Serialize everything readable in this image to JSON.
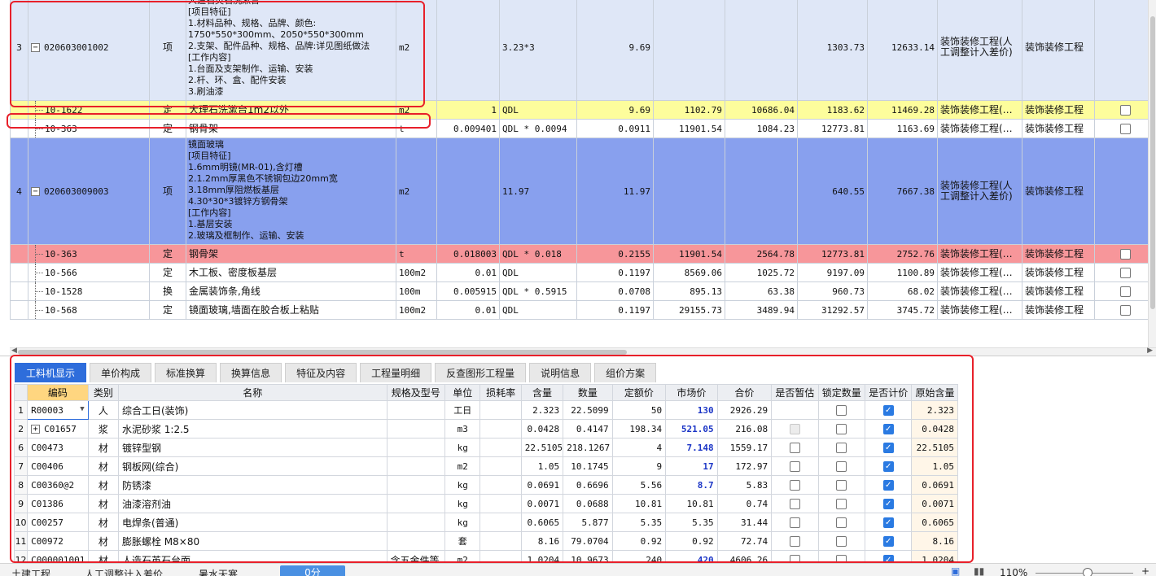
{
  "top_rows": [
    {
      "kind": "item",
      "style": "lt",
      "rownum": "3",
      "code": "020603001002",
      "type": "项",
      "desc_lines": [
        "人造石英石洗漱台",
        "[项目特征]",
        "1.材料品种、规格、品牌、颜色:",
        "1750*550*300mm、2050*550*300mm",
        "2.支架、配件品种、规格、品牌:详见图纸做法",
        "[工作内容]",
        "1.台面及支架制作、运输、安装",
        "2.杆、环、盒、配件安装",
        "3.刷油漆"
      ],
      "unit": "m2",
      "coef": "",
      "expr": "3.23*3",
      "qty": "9.69",
      "price": "",
      "amount": "",
      "comp_price": "1303.73",
      "comp_amount": "12633.14",
      "project": "装饰装修工程(人工调整计入差价)",
      "project2": "装饰装修工程",
      "check": false
    },
    {
      "kind": "sub",
      "style": "yl",
      "code": "10-1622",
      "type": "定",
      "desc": "大理石洗漱台1m2以外",
      "unit": "m2",
      "coef": "1",
      "expr": "QDL",
      "qty": "9.69",
      "price": "1102.79",
      "amount": "10686.04",
      "comp_price": "1183.62",
      "comp_amount": "11469.28",
      "project": "装饰装修工程(…",
      "project2": "装饰装修工程",
      "check": true
    },
    {
      "kind": "sub",
      "style": "wh",
      "code": "10-363",
      "type": "定",
      "desc": "钢骨架",
      "unit": "t",
      "coef": "0.009401",
      "expr": "QDL * 0.0094",
      "qty": "0.0911",
      "price": "11901.54",
      "amount": "1084.23",
      "comp_price": "12773.81",
      "comp_amount": "1163.69",
      "project": "装饰装修工程(…",
      "project2": "装饰装修工程",
      "check": true
    },
    {
      "kind": "item",
      "style": "bl",
      "rownum": "4",
      "code": "020603009003",
      "type": "项",
      "desc_lines": [
        "镜面玻璃",
        "[项目特征]",
        "1.6mm明镜(MR-01),含灯槽",
        "2.1.2mm厚黑色不锈钢包边20mm宽",
        "3.18mm厚阻燃板基层",
        "4.30*30*3镀锌方钢骨架",
        "[工作内容]",
        "1.基层安装",
        "2.玻璃及框制作、运输、安装"
      ],
      "unit": "m2",
      "coef": "",
      "expr": "11.97",
      "qty": "11.97",
      "price": "",
      "amount": "",
      "comp_price": "640.55",
      "comp_amount": "7667.38",
      "project": "装饰装修工程(人工调整计入差价)",
      "project2": "装饰装修工程",
      "check": false
    },
    {
      "kind": "sub",
      "style": "rd",
      "code": "10-363",
      "type": "定",
      "desc": "钢骨架",
      "unit": "t",
      "coef": "0.018003",
      "expr": "QDL * 0.018",
      "qty": "0.2155",
      "price": "11901.54",
      "amount": "2564.78",
      "comp_price": "12773.81",
      "comp_amount": "2752.76",
      "project": "装饰装修工程(…",
      "project2": "装饰装修工程",
      "check": true
    },
    {
      "kind": "sub",
      "style": "wh",
      "code": "10-566",
      "type": "定",
      "desc": "木工板、密度板基层",
      "unit": "100m2",
      "coef": "0.01",
      "expr": "QDL",
      "qty": "0.1197",
      "price": "8569.06",
      "amount": "1025.72",
      "comp_price": "9197.09",
      "comp_amount": "1100.89",
      "project": "装饰装修工程(…",
      "project2": "装饰装修工程",
      "check": true
    },
    {
      "kind": "sub",
      "style": "wh",
      "code": "10-1528",
      "type": "换",
      "desc": "金属装饰条,角线",
      "unit": "100m",
      "coef": "0.005915",
      "expr": "QDL * 0.5915",
      "qty": "0.0708",
      "price": "895.13",
      "amount": "63.38",
      "comp_price": "960.73",
      "comp_amount": "68.02",
      "project": "装饰装修工程(…",
      "project2": "装饰装修工程",
      "check": true
    },
    {
      "kind": "sub",
      "style": "wh",
      "code": "10-568",
      "type": "定",
      "desc": "镜面玻璃,墙面在胶合板上粘贴",
      "unit": "100m2",
      "coef": "0.01",
      "expr": "QDL",
      "qty": "0.1197",
      "price": "29155.73",
      "amount": "3489.94",
      "comp_price": "31292.57",
      "comp_amount": "3745.72",
      "project": "装饰装修工程(…",
      "project2": "装饰装修工程",
      "check": true
    }
  ],
  "tabs": [
    "工料机显示",
    "单价构成",
    "标准换算",
    "换算信息",
    "特征及内容",
    "工程量明细",
    "反查图形工程量",
    "说明信息",
    "组价方案"
  ],
  "res_headers": [
    "编码",
    "类别",
    "名称",
    "规格及型号",
    "单位",
    "损耗率",
    "含量",
    "数量",
    "定额价",
    "市场价",
    "合价",
    "是否暂估",
    "锁定数量",
    "是否计价",
    "原始含量"
  ],
  "res_rows": [
    {
      "rn": "1",
      "code": "R00003",
      "cat": "人",
      "name": "综合工日(装饰)",
      "spec": "",
      "unit": "工日",
      "loss": "",
      "content": "2.323",
      "qty": "22.5099",
      "quota": "50",
      "market": "130",
      "total": "2926.29",
      "est": "none",
      "lock": true,
      "priced": true,
      "orig": "2.323",
      "expand": false,
      "dropdown": true
    },
    {
      "rn": "2",
      "code": "C01657",
      "cat": "浆",
      "name": "水泥砂浆 1:2.5",
      "spec": "",
      "unit": "m3",
      "loss": "",
      "content": "0.0428",
      "qty": "0.4147",
      "quota": "198.34",
      "market": "521.05",
      "total": "216.08",
      "est": "disabled",
      "lock": true,
      "priced": true,
      "orig": "0.0428",
      "expand": true,
      "dropdown": false
    },
    {
      "rn": "6",
      "code": "C00473",
      "cat": "材",
      "name": "镀锌型钢",
      "spec": "",
      "unit": "kg",
      "loss": "",
      "content": "22.5105",
      "qty": "218.1267",
      "quota": "4",
      "market": "7.148",
      "total": "1559.17",
      "est": "box",
      "lock": true,
      "priced": true,
      "orig": "22.5105",
      "expand": false,
      "dropdown": false
    },
    {
      "rn": "7",
      "code": "C00406",
      "cat": "材",
      "name": "钢板网(综合)",
      "spec": "",
      "unit": "m2",
      "loss": "",
      "content": "1.05",
      "qty": "10.1745",
      "quota": "9",
      "market": "17",
      "total": "172.97",
      "est": "box",
      "lock": true,
      "priced": true,
      "orig": "1.05",
      "expand": false,
      "dropdown": false
    },
    {
      "rn": "8",
      "code": "C00360@2",
      "cat": "材",
      "name": "防锈漆",
      "spec": "",
      "unit": "kg",
      "loss": "",
      "content": "0.0691",
      "qty": "0.6696",
      "quota": "5.56",
      "market": "8.7",
      "total": "5.83",
      "est": "box",
      "lock": true,
      "priced": true,
      "orig": "0.0691",
      "expand": false,
      "dropdown": false
    },
    {
      "rn": "9",
      "code": "C01386",
      "cat": "材",
      "name": "油漆溶剂油",
      "spec": "",
      "unit": "kg",
      "loss": "",
      "content": "0.0071",
      "qty": "0.0688",
      "quota": "10.81",
      "market": "10.81",
      "total": "0.74",
      "est": "box",
      "lock": true,
      "priced": true,
      "orig": "0.0071",
      "expand": false,
      "dropdown": false
    },
    {
      "rn": "10",
      "code": "C00257",
      "cat": "材",
      "name": "电焊条(普通)",
      "spec": "",
      "unit": "kg",
      "loss": "",
      "content": "0.6065",
      "qty": "5.877",
      "quota": "5.35",
      "market": "5.35",
      "total": "31.44",
      "est": "box",
      "lock": true,
      "priced": true,
      "orig": "0.6065",
      "expand": false,
      "dropdown": false
    },
    {
      "rn": "11",
      "code": "C00972",
      "cat": "材",
      "name": "膨胀螺栓 M8×80",
      "spec": "",
      "unit": "套",
      "loss": "",
      "content": "8.16",
      "qty": "79.0704",
      "quota": "0.92",
      "market": "0.92",
      "total": "72.74",
      "est": "box",
      "lock": true,
      "priced": true,
      "orig": "8.16",
      "expand": false,
      "dropdown": false
    },
    {
      "rn": "12",
      "code": "C000001001",
      "cat": "材",
      "name": "人造石英石台面",
      "spec": "含五金件等",
      "unit": "m2",
      "loss": "",
      "content": "1.0204",
      "qty": "10.9673",
      "quota": "240",
      "market": "420",
      "total": "4606.26",
      "est": "box",
      "lock": true,
      "priced": true,
      "orig": "1.0204",
      "expand": false,
      "dropdown": false
    }
  ],
  "marked_market": [
    "130",
    "521.05",
    "7.148",
    "17",
    "8.7",
    "420"
  ],
  "status": {
    "item1": "土建工程",
    "item2": "人工调整计入差价",
    "item3": "暑水天寒",
    "btn": "0分",
    "zoom": "110%"
  },
  "colors": {
    "accent": "#2e6ddb",
    "highlight_red": "#e8202a",
    "row_yellow": "#fdfd9c",
    "row_blue": "#88a0ee",
    "row_red": "#f7969a"
  }
}
